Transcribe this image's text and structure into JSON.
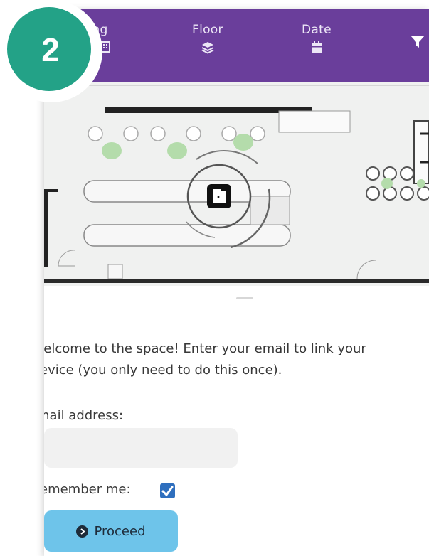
{
  "step": {
    "number": "2"
  },
  "nav": {
    "building_label": "lding",
    "floor_label": "Floor",
    "date_label": "Date"
  },
  "form": {
    "welcome_line1": "Jelcome to the space! Enter your email to link your",
    "welcome_line2": "evice (you only need to do this once).",
    "email_label": "mail address:",
    "email_value": "",
    "remember_label": "emember me:",
    "remember_checked": true,
    "proceed_label": "Proceed"
  },
  "colors": {
    "topbar": "#6a3e9b",
    "step_badge": "#23a287",
    "proceed_button": "#6ec4ea",
    "checkbox": "#2f6fbe",
    "chair_green": "#b4dcab"
  },
  "icons": {
    "building": "building-icon",
    "floor": "layers-icon",
    "date": "calendar-icon",
    "filter": "filter-icon",
    "door": "door-icon",
    "proceed": "arrow-circle-icon"
  }
}
